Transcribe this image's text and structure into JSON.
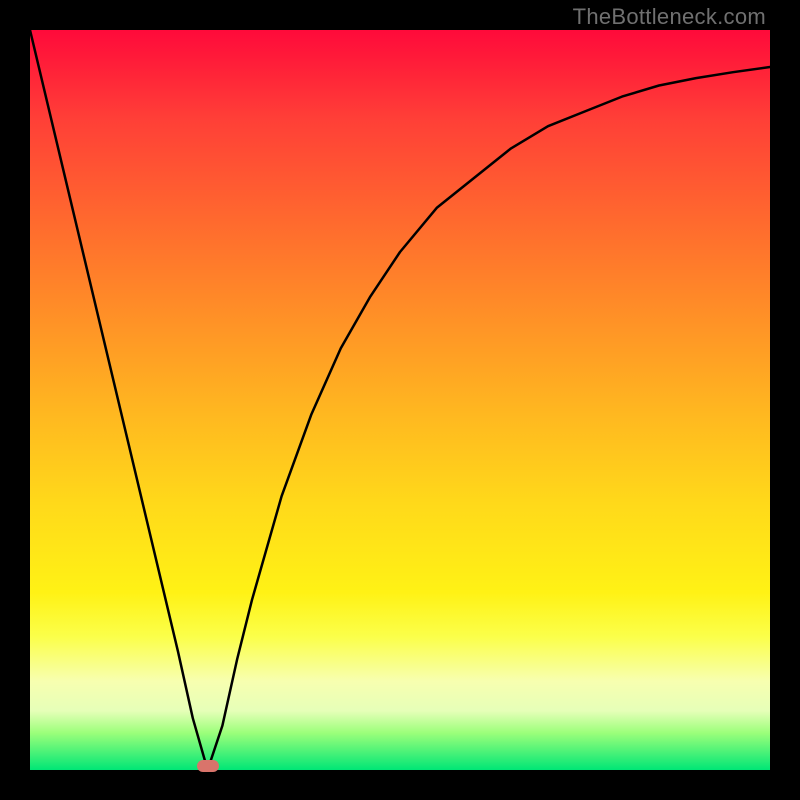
{
  "watermark": "TheBottleneck.com",
  "colors": {
    "background": "#000000",
    "gradient_top": "#ff0a3a",
    "gradient_bottom": "#00e676",
    "curve": "#000000",
    "marker": "#d9746b",
    "watermark_text": "#707070"
  },
  "chart_data": {
    "type": "line",
    "title": "",
    "xlabel": "",
    "ylabel": "",
    "xlim": [
      0,
      100
    ],
    "ylim": [
      0,
      100
    ],
    "grid": false,
    "legend_position": "none",
    "series": [
      {
        "name": "bottleneck-curve",
        "x": [
          0,
          5,
          10,
          15,
          20,
          22,
          24,
          26,
          28,
          30,
          34,
          38,
          42,
          46,
          50,
          55,
          60,
          65,
          70,
          75,
          80,
          85,
          90,
          95,
          100
        ],
        "y": [
          100,
          79,
          58,
          37,
          16,
          7,
          0,
          6,
          15,
          23,
          37,
          48,
          57,
          64,
          70,
          76,
          80,
          84,
          87,
          89,
          91,
          92.5,
          93.5,
          94.3,
          95
        ]
      }
    ],
    "annotations": [
      {
        "name": "minimum-marker",
        "x": 24,
        "y": 0.5,
        "shape": "pill",
        "color": "#d9746b"
      }
    ],
    "notes": "y is plotted increasing downward in the visual (higher y = closer to top/red)."
  }
}
